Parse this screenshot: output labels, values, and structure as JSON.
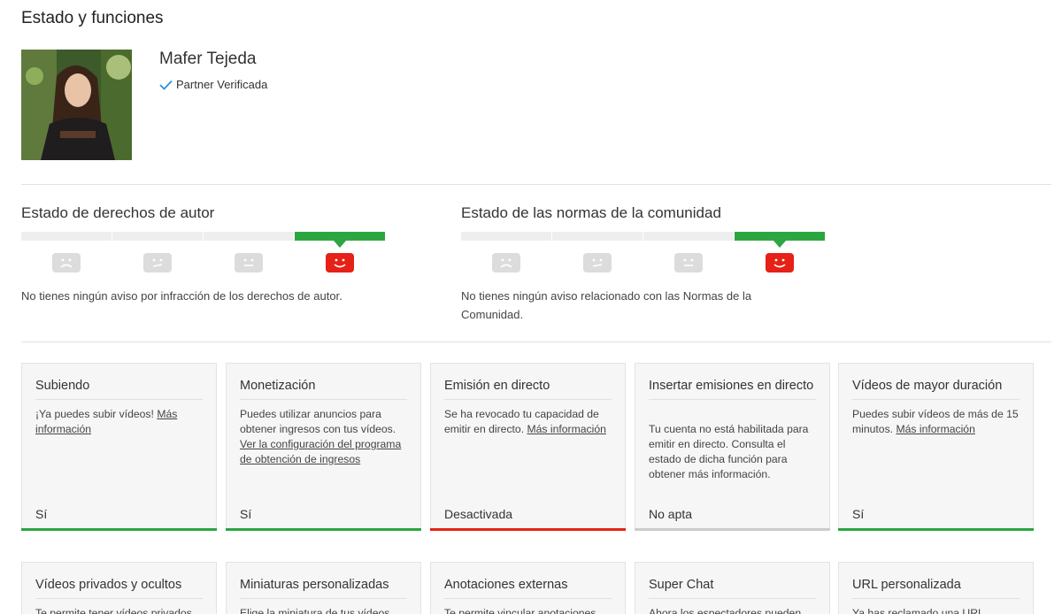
{
  "page": {
    "title": "Estado y funciones"
  },
  "channel": {
    "name": "Mafer Tejeda",
    "verified_label": "Partner Verificada"
  },
  "copyright": {
    "title": "Estado de derechos de autor",
    "level": 4,
    "description": "No tienes ningún aviso por infracción de los derechos de autor."
  },
  "community": {
    "title": "Estado de las normas de la comunidad",
    "level": 4,
    "description": "No tienes ningún aviso relacionado con las Normas de la Comunidad."
  },
  "colors": {
    "good": "#2ba640",
    "bad": "#e62117",
    "neutral": "#cccccc",
    "face_active": "#e62117",
    "face_inactive": "#dcdcdc"
  },
  "features": [
    {
      "title": "Subiendo",
      "text": "¡Ya puedes subir vídeos! ",
      "link": "Más información",
      "status": "Sí",
      "state": "good"
    },
    {
      "title": "Monetización",
      "text": "Puedes utilizar anuncios para obtener ingresos con tus vídeos. ",
      "link": "Ver la configuración del programa de obtención de ingresos",
      "status": "Sí",
      "state": "good"
    },
    {
      "title": "Emisión en directo",
      "text": "Se ha revocado tu capacidad de emitir en directo. ",
      "link": "Más información",
      "status": "Desactivada",
      "state": "bad"
    },
    {
      "title": "Insertar emisiones en directo",
      "text": "Tu cuenta no está habilitada para emitir en directo. Consulta el estado de dicha función para obtener más información.",
      "link": "",
      "status": "No apta",
      "state": "neutral"
    },
    {
      "title": "Vídeos de mayor duración",
      "text": "Puedes subir vídeos de más de 15 minutos. ",
      "link": "Más información",
      "status": "Sí",
      "state": "good"
    }
  ],
  "features_row2": [
    {
      "title": "Vídeos privados y ocultos",
      "text": "Te permite tener vídeos privados"
    },
    {
      "title": "Miniaturas personalizadas",
      "text": "Elige la miniatura de tus vídeos"
    },
    {
      "title": "Anotaciones externas",
      "text": "Te permite vincular anotaciones"
    },
    {
      "title": "Super Chat",
      "text": "Ahora los espectadores pueden"
    },
    {
      "title": "URL personalizada",
      "text": "Ya has reclamado una URL"
    }
  ]
}
